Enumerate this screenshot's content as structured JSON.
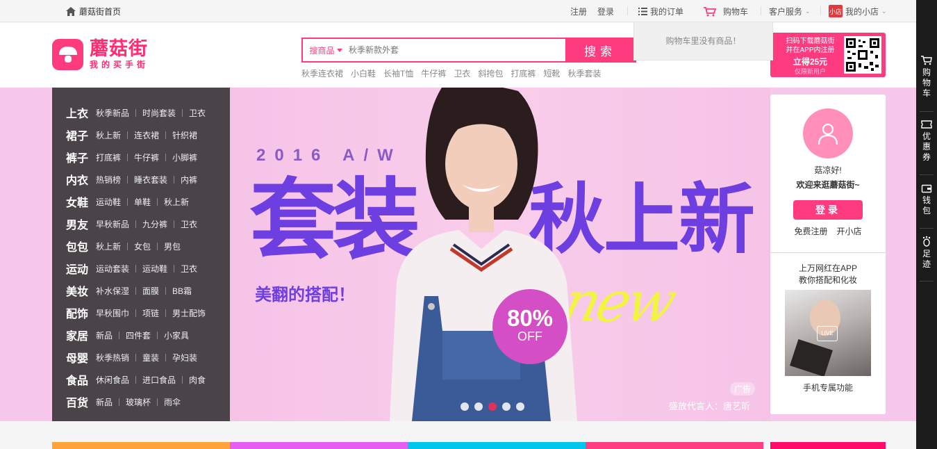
{
  "topbar": {
    "home": "蘑菇街首页",
    "register": "注册",
    "login": "登录",
    "orders": "我的订单",
    "cart": "购物车",
    "service": "客户服务",
    "shop_badge": "小店",
    "my_shop": "我的小店",
    "cart_empty": "购物车里没有商品！"
  },
  "header": {
    "logo_name": "蘑菇街",
    "logo_slogan": "我的买手街",
    "search_category": "搜商品",
    "search_placeholder": "秋季新款外套",
    "search_button": "搜索",
    "hotwords": [
      "秋季连衣裙",
      "小白鞋",
      "长袖T恤",
      "牛仔裤",
      "卫衣",
      "斜挎包",
      "打底裤",
      "短靴",
      "秋季套装"
    ],
    "qr_line1": "扫码下载蘑菇街",
    "qr_line2": "并在APP内注册",
    "qr_amount": "立得25元",
    "qr_note": "仅限新用户"
  },
  "categories": [
    {
      "main": "上衣",
      "subs": [
        "秋季新品",
        "时尚套装",
        "卫衣"
      ]
    },
    {
      "main": "裙子",
      "subs": [
        "秋上新",
        "连衣裙",
        "针织裙"
      ]
    },
    {
      "main": "裤子",
      "subs": [
        "打底裤",
        "牛仔裤",
        "小脚裤"
      ]
    },
    {
      "main": "内衣",
      "subs": [
        "热销榜",
        "睡衣套装",
        "内裤"
      ]
    },
    {
      "main": "女鞋",
      "subs": [
        "运动鞋",
        "单鞋",
        "秋上新"
      ]
    },
    {
      "main": "男友",
      "subs": [
        "早秋新品",
        "九分裤",
        "卫衣"
      ]
    },
    {
      "main": "包包",
      "subs": [
        "秋上新",
        "女包",
        "男包"
      ]
    },
    {
      "main": "运动",
      "subs": [
        "运动套装",
        "运动鞋",
        "卫衣"
      ]
    },
    {
      "main": "美妆",
      "subs": [
        "补水保湿",
        "面膜",
        "BB霜"
      ]
    },
    {
      "main": "配饰",
      "subs": [
        "早秋围巾",
        "项链",
        "男士配饰"
      ]
    },
    {
      "main": "家居",
      "subs": [
        "新品",
        "四件套",
        "小家具"
      ]
    },
    {
      "main": "母婴",
      "subs": [
        "秋季热销",
        "童装",
        "孕妇装"
      ]
    },
    {
      "main": "食品",
      "subs": [
        "休闲食品",
        "进口食品",
        "肉食"
      ]
    },
    {
      "main": "百货",
      "subs": [
        "新品",
        "玻璃杯",
        "雨伞"
      ]
    }
  ],
  "banner": {
    "season": "2016 A/W",
    "headline_left": "套装",
    "headline_right": "秋上新",
    "tagline": "美翻的搭配！",
    "new_word": "new",
    "discount": "80%",
    "discount_sub": "OFF",
    "ad_label": "广告",
    "spokesperson": "盛放代言人：唐艺昕",
    "active_slide": 3,
    "slide_count": 5
  },
  "user_card": {
    "greeting": "菇凉好!",
    "welcome": "欢迎来逛蘑菇街~",
    "login_button": "登录",
    "register": "免费注册",
    "open_shop": "开小店",
    "app_line1": "上万网红在APP",
    "app_line2": "教你搭配和化妆",
    "live_badge": "LIVE",
    "app_footer": "手机专属功能"
  },
  "sidebar": {
    "cart": "购物车",
    "coupon": "优惠券",
    "wallet": "钱包",
    "footprint": "足迹"
  },
  "colors": {
    "brand": "#ff3b7f",
    "menu_bg": "#4a4449",
    "banner_bg": "#f7c8ec",
    "headline": "#6e3fe0",
    "strips": [
      "#ffa33a",
      "#e45ef2",
      "#00c6ec",
      "#ff3d82",
      "#ff0b6a"
    ]
  }
}
